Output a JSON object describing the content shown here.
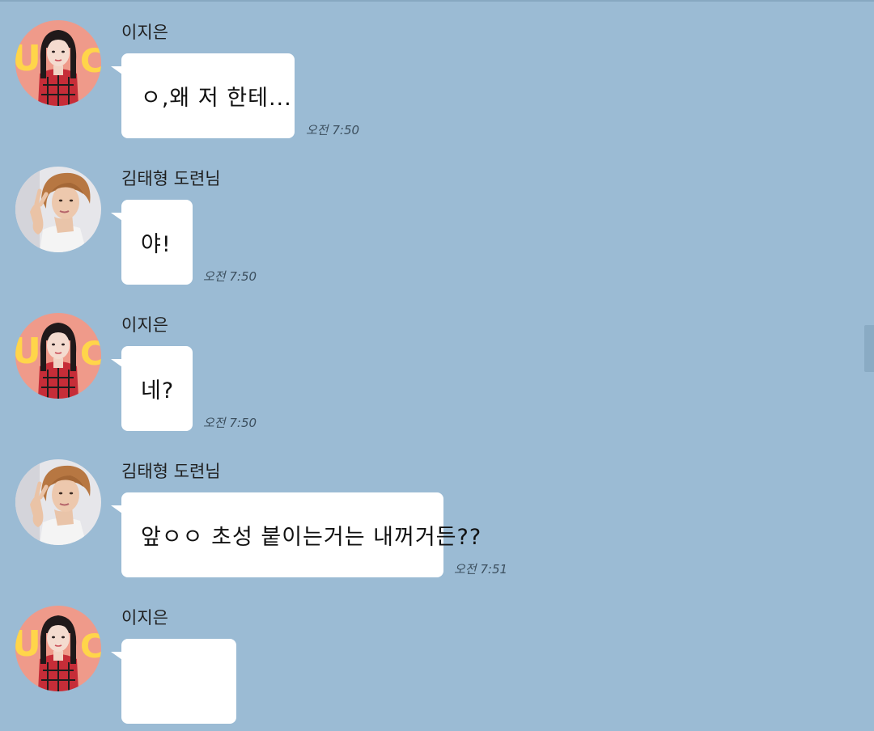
{
  "colors": {
    "background": "#9bbbd4",
    "bubble": "#ffffff",
    "timestamp": "#3c4f5e"
  },
  "messages": [
    {
      "sender": "이지은",
      "avatar": "iu-avatar",
      "text": "ㅇ,왜 저 한테...",
      "time": "오전 7:50"
    },
    {
      "sender": "김태형 도련님",
      "avatar": "taehyung-avatar",
      "text": "야!",
      "time": "오전 7:50"
    },
    {
      "sender": "이지은",
      "avatar": "iu-avatar",
      "text": "네?",
      "time": "오전 7:50"
    },
    {
      "sender": "김태형 도련님",
      "avatar": "taehyung-avatar",
      "text": "앞ㅇㅇ 초성 붙이는거는 내꺼거든??",
      "time": "오전 7:51"
    },
    {
      "sender": "이지은",
      "avatar": "iu-avatar",
      "text": "",
      "time": ""
    }
  ]
}
